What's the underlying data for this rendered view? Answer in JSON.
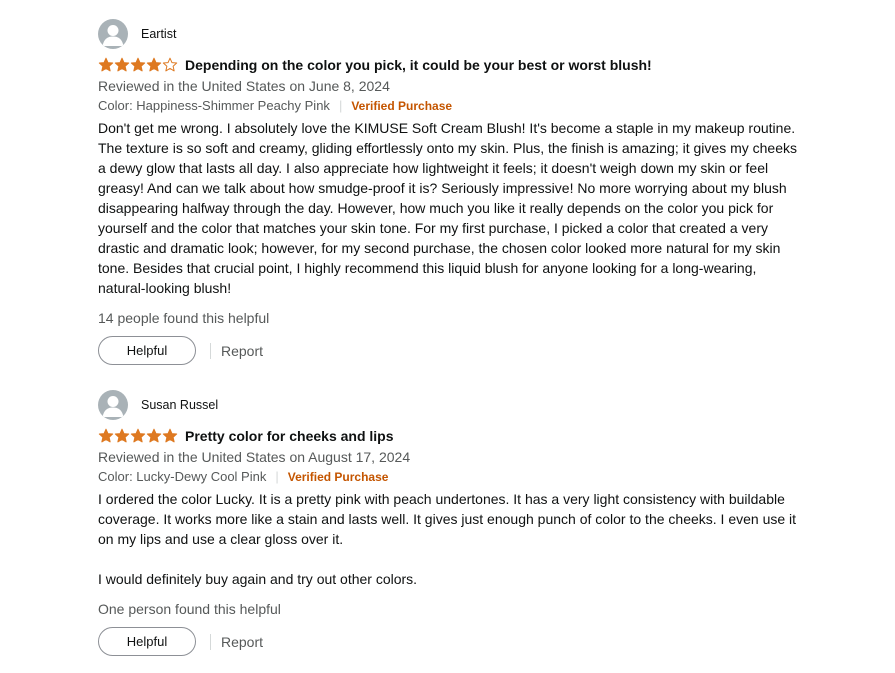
{
  "colors": {
    "star": "#de7921",
    "verified": "#c45500",
    "muted": "#565959"
  },
  "reviews": [
    {
      "profile_name": "Eartist",
      "rating": 4,
      "title": "Depending on the color you pick, it could be your best or worst blush!",
      "date": "Reviewed in the United States on June 8, 2024",
      "color": "Color: Happiness-Shimmer Peachy Pink",
      "verified": "Verified Purchase",
      "body": [
        "Don't get me wrong. I absolutely love the KIMUSE Soft Cream Blush! It's become a staple in my makeup routine. The texture is so soft and creamy, gliding effortlessly onto my skin. Plus, the finish is amazing; it gives my cheeks a dewy glow that lasts all day. I also appreciate how lightweight it feels; it doesn't weigh down my skin or feel greasy! And can we talk about how smudge-proof it is? Seriously impressive! No more worrying about my blush disappearing halfway through the day. However, how much you like it really depends on the color you pick for yourself and the color that matches your skin tone. For my first purchase, I picked a color that created a very drastic and dramatic look; however, for my second purchase, the chosen color looked more natural for my skin tone. Besides that crucial point, I highly recommend this liquid blush for anyone looking for a long-wearing, natural-looking blush!"
      ],
      "helpful_count": "14 people found this helpful",
      "helpful_label": "Helpful",
      "report_label": "Report"
    },
    {
      "profile_name": "Susan Russel",
      "rating": 5,
      "title": "Pretty color for cheeks and lips",
      "date": "Reviewed in the United States on August 17, 2024",
      "color": "Color: Lucky-Dewy Cool Pink",
      "verified": "Verified Purchase",
      "body": [
        "I ordered the color Lucky. It is a pretty pink with peach undertones. It has a very light consistency with buildable coverage. It works more like a stain and lasts well. It gives just enough punch of color to the cheeks. I even use it on my lips and use a clear gloss over it.",
        "I would definitely buy again and try out other colors."
      ],
      "helpful_count": "One person found this helpful",
      "helpful_label": "Helpful",
      "report_label": "Report"
    }
  ]
}
